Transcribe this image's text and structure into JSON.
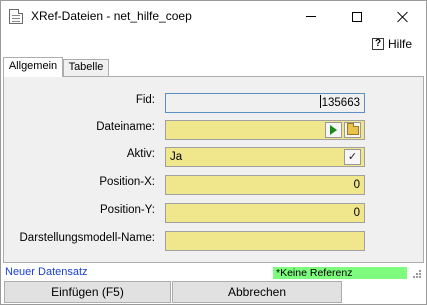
{
  "window": {
    "title": "XRef-Dateien - net_hilfe_coep"
  },
  "help": {
    "label": "Hilfe",
    "icon": "?"
  },
  "tabs": [
    {
      "label": "Allgemein",
      "active": true
    },
    {
      "label": "Tabelle",
      "active": false
    }
  ],
  "form": {
    "fid": {
      "label": "Fid:",
      "value": "135663"
    },
    "dateiname": {
      "label": "Dateiname:",
      "value": ""
    },
    "aktiv": {
      "label": "Aktiv:",
      "value": "Ja",
      "check_symbol": "✓"
    },
    "position_x": {
      "label": "Position-X:",
      "value": "0"
    },
    "position_y": {
      "label": "Position-Y:",
      "value": "0"
    },
    "darstellungsmodell": {
      "label": "Darstellungsmodell-Name:",
      "value": ""
    }
  },
  "status": {
    "record_state": "Neuer Datensatz",
    "reference": "*Keine Referenz"
  },
  "buttons": {
    "insert": "Einfügen (F5)",
    "cancel": "Abbrechen"
  },
  "colors": {
    "field_fill": "#f0e68c",
    "status_new": "#1a3fcf",
    "status_ref": "#7dfc7d",
    "play_green": "#1a8a1a"
  }
}
